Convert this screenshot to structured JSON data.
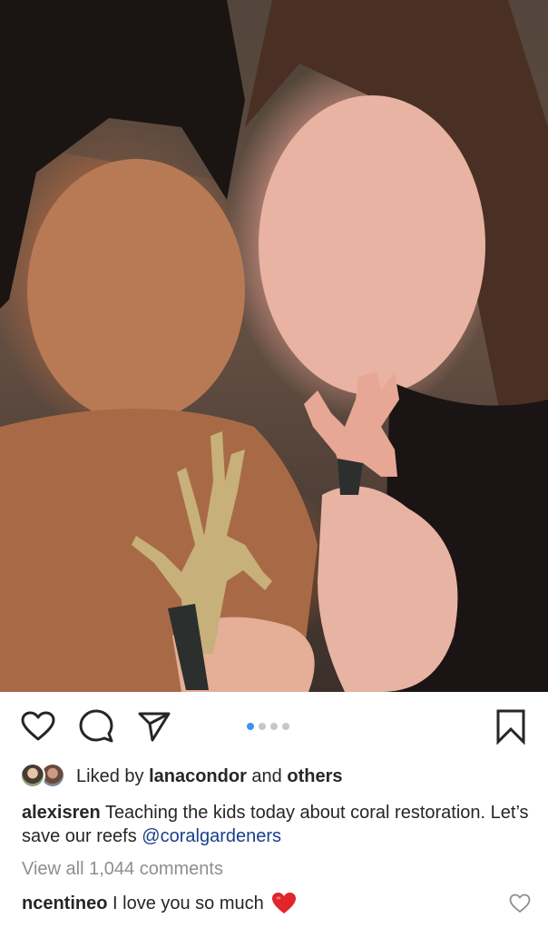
{
  "post": {
    "liked_by_prefix": "Liked by",
    "liked_by_user": "lanacondor",
    "liked_by_and": "and",
    "liked_by_others": "others",
    "caption_user": "alexisren",
    "caption_text": "Teaching the kids today about coral restoration. Let’s save our reefs",
    "caption_mention": "@coralgardeners",
    "view_all": "View all 1,044 comments",
    "comment_user": "ncentineo",
    "comment_text": "I love you so much",
    "carousel": {
      "count": 4,
      "active_index": 0
    }
  },
  "icons": {
    "like": "heart-outline-icon",
    "comment": "comment-bubble-icon",
    "share": "paper-plane-icon",
    "save": "bookmark-icon",
    "comment_like": "small-heart-outline-icon",
    "comment_emoji": "red-heart-emoji"
  },
  "colors": {
    "text": "#262626",
    "muted": "#8e8e8e",
    "mention": "#1a3e8c",
    "carousel_active": "#3897f0",
    "carousel_inactive": "#c7c7c7",
    "emoji_heart": "#e0262a"
  }
}
